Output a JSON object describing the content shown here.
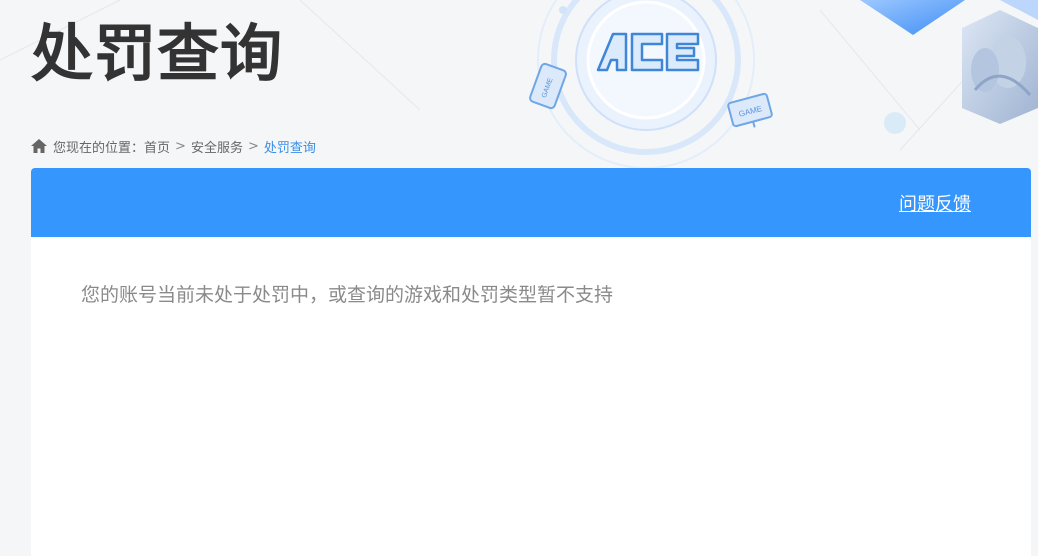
{
  "page": {
    "title": "处罚查询"
  },
  "breadcrumb": {
    "prefix": "您现在的位置：",
    "items": [
      {
        "label": "首页"
      },
      {
        "label": "安全服务"
      },
      {
        "label": "处罚查询"
      }
    ],
    "separator": ">"
  },
  "logo": {
    "text": "ACE",
    "badge_text": "GAME"
  },
  "header": {
    "feedback_label": "问题反馈"
  },
  "result": {
    "message": "您的账号当前未处于处罚中，或查询的游戏和处罚类型暂不支持"
  },
  "colors": {
    "accent": "#3596fe",
    "title": "#333333",
    "breadcrumb_current": "#3a8ee6"
  }
}
